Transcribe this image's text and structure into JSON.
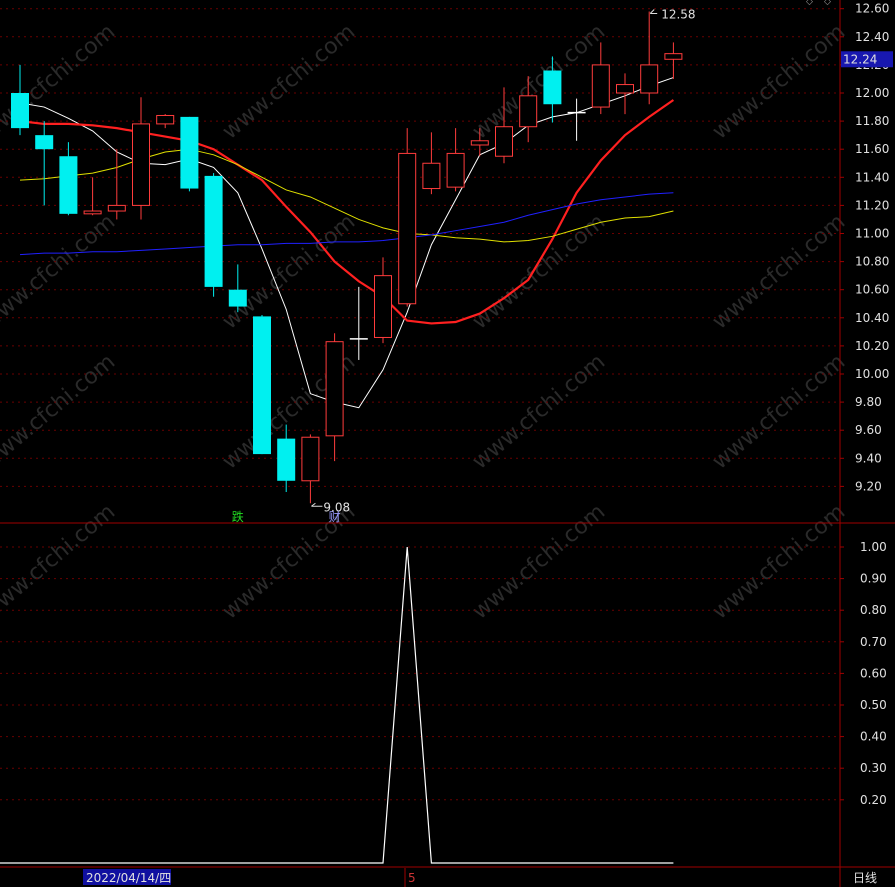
{
  "chart_data": [
    {
      "type": "candlestick",
      "ylim": [
        9.0,
        12.65
      ],
      "y_ticks": [
        "12.60",
        "12.40",
        "12.20",
        "12.00",
        "11.80",
        "11.60",
        "11.40",
        "11.20",
        "11.00",
        "10.80",
        "10.60",
        "10.40",
        "10.20",
        "10.00",
        "9.80",
        "9.60",
        "9.40",
        "9.20"
      ],
      "current_price": "12.24",
      "high_label": "12.58",
      "low_label": "9.08",
      "markers": [
        {
          "text": "跌",
          "index": 9,
          "kind": "die"
        },
        {
          "text": "财",
          "index": 13,
          "kind": "cai"
        }
      ],
      "candles": [
        {
          "o": 12.0,
          "h": 12.2,
          "l": 11.7,
          "c": 11.75
        },
        {
          "o": 11.7,
          "h": 11.8,
          "l": 11.2,
          "c": 11.6
        },
        {
          "o": 11.55,
          "h": 11.65,
          "l": 11.13,
          "c": 11.14
        },
        {
          "o": 11.14,
          "h": 11.4,
          "l": 11.13,
          "c": 11.16
        },
        {
          "o": 11.16,
          "h": 11.6,
          "l": 11.1,
          "c": 11.2
        },
        {
          "o": 11.2,
          "h": 11.97,
          "l": 11.1,
          "c": 11.78
        },
        {
          "o": 11.78,
          "h": 11.85,
          "l": 11.75,
          "c": 11.84
        },
        {
          "o": 11.83,
          "h": 11.83,
          "l": 11.3,
          "c": 11.32
        },
        {
          "o": 11.41,
          "h": 11.43,
          "l": 10.55,
          "c": 10.62
        },
        {
          "o": 10.6,
          "h": 10.78,
          "l": 10.44,
          "c": 10.48
        },
        {
          "o": 10.41,
          "h": 10.42,
          "l": 9.43,
          "c": 9.43
        },
        {
          "o": 9.54,
          "h": 9.64,
          "l": 9.16,
          "c": 9.24
        },
        {
          "o": 9.24,
          "h": 9.57,
          "l": 9.08,
          "c": 9.55
        },
        {
          "o": 9.56,
          "h": 10.29,
          "l": 9.38,
          "c": 10.23
        },
        {
          "o": 10.25,
          "h": 10.62,
          "l": 10.1,
          "c": 10.25
        },
        {
          "o": 10.26,
          "h": 10.83,
          "l": 10.22,
          "c": 10.7
        },
        {
          "o": 10.5,
          "h": 11.75,
          "l": 10.48,
          "c": 11.57
        },
        {
          "o": 11.32,
          "h": 11.72,
          "l": 11.28,
          "c": 11.5
        },
        {
          "o": 11.33,
          "h": 11.75,
          "l": 11.3,
          "c": 11.57
        },
        {
          "o": 11.63,
          "h": 11.75,
          "l": 11.55,
          "c": 11.66
        },
        {
          "o": 11.55,
          "h": 12.04,
          "l": 11.5,
          "c": 11.76
        },
        {
          "o": 11.76,
          "h": 12.12,
          "l": 11.65,
          "c": 11.98
        },
        {
          "o": 12.16,
          "h": 12.26,
          "l": 11.79,
          "c": 11.92
        },
        {
          "o": 11.86,
          "h": 11.96,
          "l": 11.66,
          "c": 11.86
        },
        {
          "o": 11.9,
          "h": 12.36,
          "l": 11.85,
          "c": 12.2
        },
        {
          "o": 12.0,
          "h": 12.14,
          "l": 11.85,
          "c": 12.06
        },
        {
          "o": 12.0,
          "h": 12.58,
          "l": 11.92,
          "c": 12.2
        },
        {
          "o": 12.24,
          "h": 12.36,
          "l": 12.1,
          "c": 12.28
        }
      ],
      "series": [
        {
          "color": "#ffffff",
          "values": [
            11.93,
            11.9,
            11.82,
            11.73,
            11.58,
            11.5,
            11.49,
            11.53,
            11.47,
            11.29,
            10.89,
            10.46,
            9.86,
            9.8,
            9.76,
            10.03,
            10.44,
            10.92,
            11.24,
            11.56,
            11.64,
            11.77,
            11.83,
            11.86,
            11.92,
            11.98,
            12.05,
            12.11
          ]
        },
        {
          "color": "#ff2020",
          "values": [
            11.8,
            11.78,
            11.78,
            11.77,
            11.75,
            11.72,
            11.69,
            11.66,
            11.6,
            11.49,
            11.38,
            11.19,
            11.01,
            10.8,
            10.66,
            10.55,
            10.38,
            10.36,
            10.37,
            10.43,
            10.54,
            10.67,
            10.96,
            11.29,
            11.52,
            11.7,
            11.83,
            11.95
          ]
        },
        {
          "color": "#e0e000",
          "values": [
            11.38,
            11.39,
            11.41,
            11.43,
            11.47,
            11.53,
            11.58,
            11.6,
            11.56,
            11.49,
            11.4,
            11.31,
            11.26,
            11.18,
            11.1,
            11.04,
            11.0,
            10.99,
            10.97,
            10.96,
            10.94,
            10.95,
            10.98,
            11.03,
            11.08,
            11.11,
            11.12,
            11.16
          ]
        },
        {
          "color": "#2020ff",
          "values": [
            10.85,
            10.86,
            10.86,
            10.87,
            10.87,
            10.88,
            10.89,
            10.9,
            10.91,
            10.92,
            10.92,
            10.93,
            10.93,
            10.94,
            10.94,
            10.95,
            10.97,
            10.99,
            11.02,
            11.05,
            11.08,
            11.13,
            11.17,
            11.21,
            11.24,
            11.26,
            11.28,
            11.29
          ]
        }
      ]
    },
    {
      "type": "line",
      "ylim": [
        0.0,
        1.05
      ],
      "y_ticks": [
        "1.00",
        "0.90",
        "0.80",
        "0.70",
        "0.60",
        "0.50",
        "0.40",
        "0.30",
        "0.20"
      ],
      "series": [
        {
          "color": "#ffffff",
          "values": [
            0,
            0,
            0,
            0,
            0,
            0,
            0,
            0,
            0,
            0,
            0,
            0,
            0,
            0,
            0,
            0,
            1,
            0,
            0,
            0,
            0,
            0,
            0,
            0,
            0,
            0,
            0,
            0
          ]
        }
      ]
    }
  ],
  "footer": {
    "date_label": "2022/04/14/四",
    "marker_5": "5",
    "period_label": "日线"
  },
  "watermark": "www.cfchi.com"
}
